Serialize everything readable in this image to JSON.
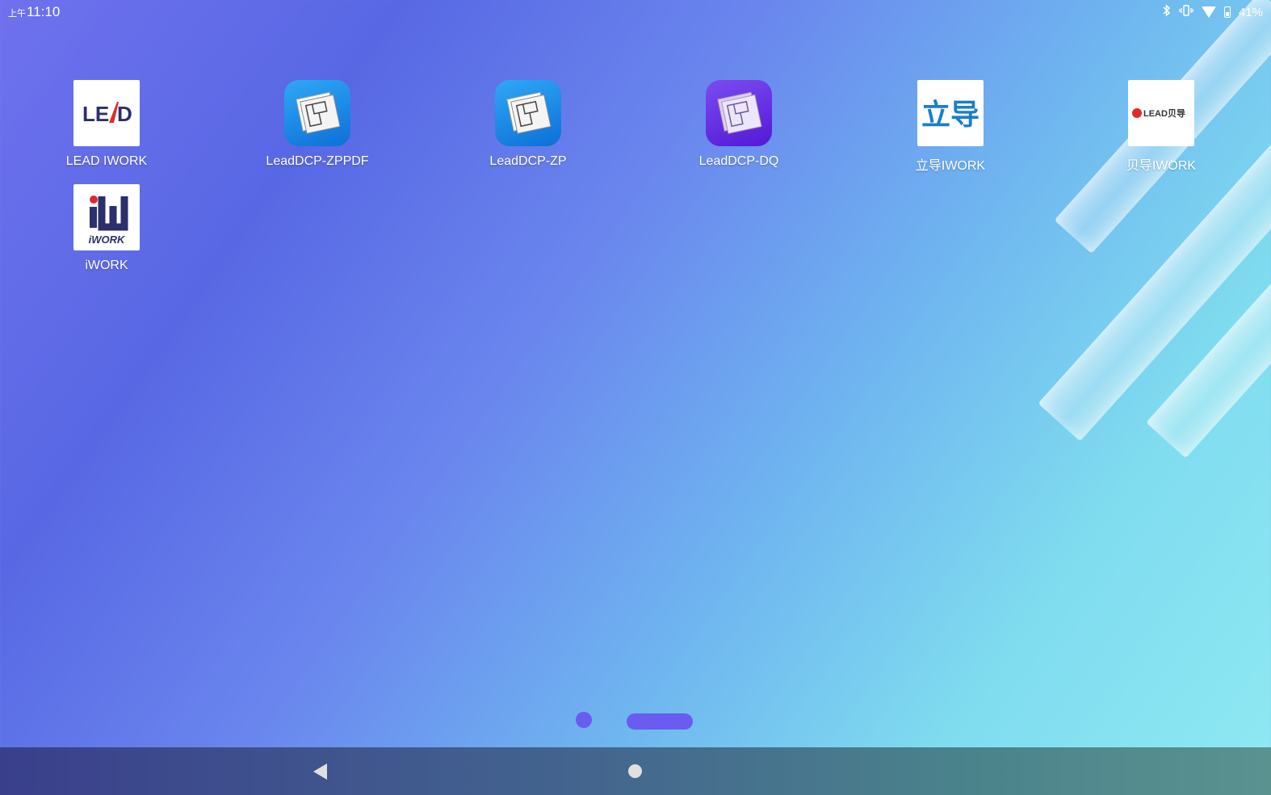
{
  "status_bar": {
    "ampm": "上午",
    "time": "11:10",
    "battery_percent": "41%"
  },
  "apps": [
    {
      "label": "LEAD IWORK",
      "icon": "lead-logo-icon",
      "icon_text": "LE/\\D"
    },
    {
      "label": "LeadDCP-ZPPDF",
      "icon": "floorplan-blue-icon"
    },
    {
      "label": "LeadDCP-ZP",
      "icon": "floorplan-blue-icon"
    },
    {
      "label": "LeadDCP-DQ",
      "icon": "floorplan-purple-icon"
    },
    {
      "label": "立导IWORK",
      "icon": "lidao-logo-icon",
      "icon_text": "立导"
    },
    {
      "label": "贝导IWORK",
      "icon": "beidao-logo-icon",
      "icon_text": "LEAD贝导"
    },
    {
      "label": "iWORK",
      "icon": "iwork-logo-icon",
      "icon_text": "iWORK"
    }
  ],
  "pager": {
    "pages": 2,
    "current": 2
  },
  "colors": {
    "accent_pager": "#6a5cf0",
    "lidao_blue": "#1a7fc8",
    "lead_red": "#e02a2a",
    "iwork_navy": "#2b2f6b"
  }
}
